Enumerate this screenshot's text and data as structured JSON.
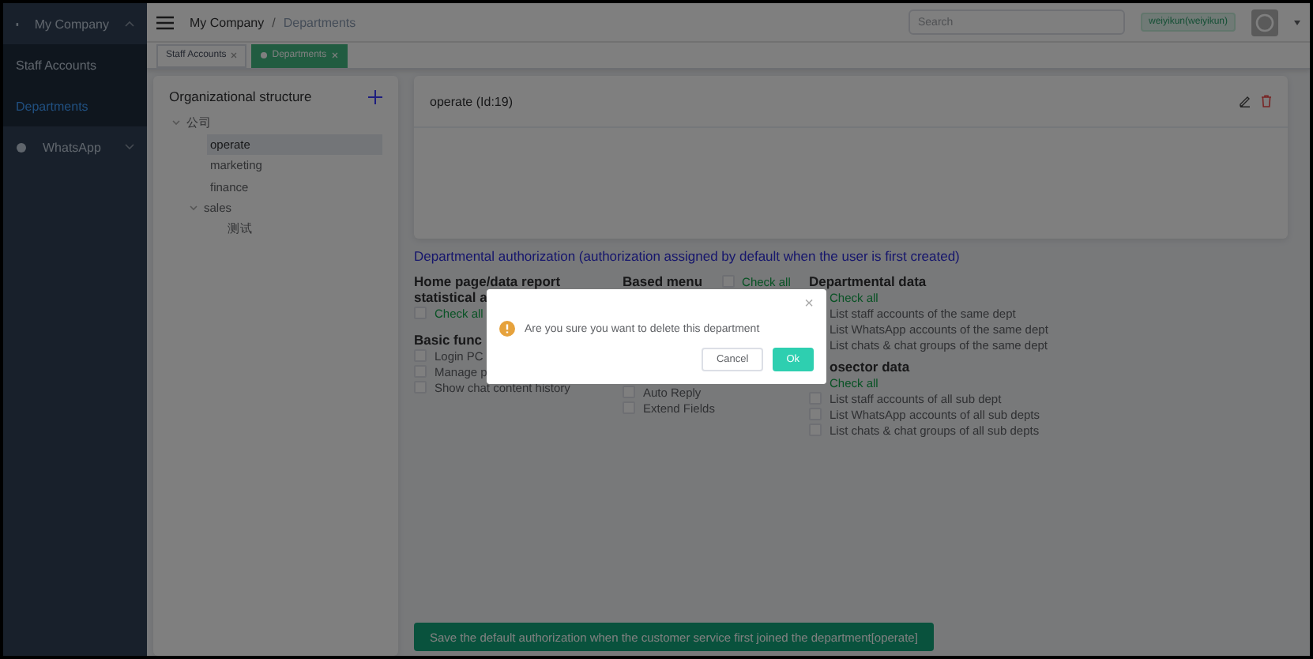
{
  "sidebar": {
    "company": {
      "label": "My Company",
      "expanded": true
    },
    "items": [
      {
        "label": "Staff Accounts",
        "selected": false
      },
      {
        "label": "Departments",
        "selected": true
      }
    ],
    "whatsapp": {
      "label": "WhatsApp",
      "expanded": false
    }
  },
  "header": {
    "breadcrumb": [
      "My Company",
      "Departments"
    ],
    "separator": "/",
    "search": {
      "placeholder": "Search"
    },
    "user": "weiyikun(weiyikun)"
  },
  "tabs": [
    {
      "label": "Staff Accounts",
      "selected": false
    },
    {
      "label": "Departments",
      "selected": true
    }
  ],
  "org": {
    "title": "Organizational structure",
    "tree": [
      {
        "label": "公司",
        "expanded": true,
        "selected": false,
        "children": [
          {
            "label": "operate",
            "selected": true
          },
          {
            "label": "marketing",
            "selected": false
          },
          {
            "label": "finance",
            "selected": false
          },
          {
            "label": "sales",
            "expanded": true,
            "selected": false,
            "children": [
              {
                "label": "测试",
                "selected": false
              }
            ]
          }
        ]
      }
    ]
  },
  "detail": {
    "title": "operate (Id:19)"
  },
  "authorization": {
    "title": "Departmental authorization (authorization assigned by default when the user is first created)",
    "columns": [
      {
        "sections": [
          {
            "title": "Home page/data report statistical a",
            "check_all": {
              "label": "Check all",
              "checked": false
            }
          },
          {
            "title": "Basic func",
            "items": [
              {
                "label": "Login PC",
                "checked": false
              },
              {
                "label": "Manage p",
                "checked": false
              },
              {
                "label": "Show chat content history",
                "checked": false
              }
            ]
          }
        ]
      },
      {
        "sections": [
          {
            "title": "Based menu",
            "inline_check_all": true,
            "check_all": {
              "label": "Check all",
              "checked": false
            },
            "items": [
              {
                "label": "Auto Reply",
                "checked": false
              },
              {
                "label": "Extend Fields",
                "checked": false
              }
            ]
          }
        ]
      },
      {
        "sections": [
          {
            "title": "Departmental data",
            "check_all": {
              "label": "Check all"
            },
            "items": [
              {
                "label": "List staff accounts of the same dept"
              },
              {
                "label": "List WhatsApp accounts of the same dept"
              },
              {
                "label": "List chats & chat groups of the same dept"
              }
            ]
          },
          {
            "title": "osector data",
            "title_cut": true,
            "check_all": {
              "label": "Check all"
            },
            "items": [
              {
                "label": "List staff accounts of all sub dept",
                "checked": false
              },
              {
                "label": "List WhatsApp accounts of all sub depts",
                "checked": false
              },
              {
                "label": "List chats & chat groups of all sub depts",
                "checked": false
              }
            ]
          }
        ]
      }
    ],
    "save_button": "Save the default authorization when the customer service first joined the department[operate]"
  },
  "dialog": {
    "message": "Are you sure you want to delete this department",
    "close": "×",
    "cancel": "Cancel",
    "ok": "Ok"
  }
}
